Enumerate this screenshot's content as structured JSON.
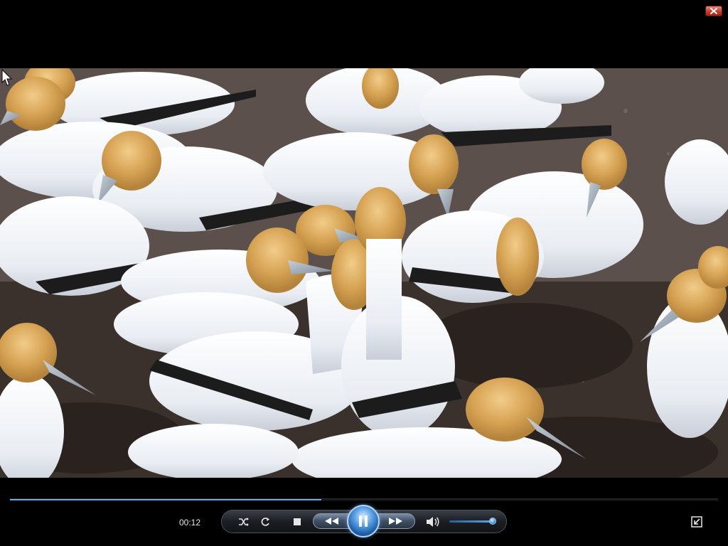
{
  "window": {
    "close_icon": "close-x-icon"
  },
  "video": {
    "content": "gannet-colony"
  },
  "seek": {
    "progress": 0.44
  },
  "time": {
    "elapsed": "00:12"
  },
  "controls": {
    "shuffle_icon": "shuffle-icon",
    "repeat_icon": "repeat-icon",
    "stop_icon": "stop-icon",
    "previous_icon": "previous-rewind-icon",
    "play_icon": "pause-icon",
    "next_icon": "next-forward-icon",
    "mute_icon": "speaker-icon",
    "volume_level": 0.92,
    "fullscreen_icon": "exit-fullscreen-icon"
  },
  "colors": {
    "accent": "#3b7fc4",
    "close": "#c2402e",
    "background": "#000000"
  }
}
